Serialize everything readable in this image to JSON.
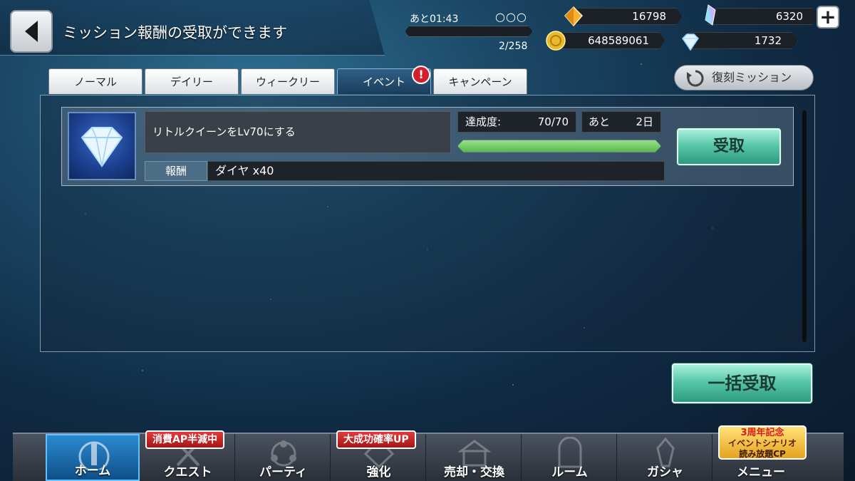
{
  "header": {
    "title": "ミッション報酬の受取ができます",
    "timer": "あと01:43",
    "stamina_circles": "○○○",
    "stamina_count": "2/258"
  },
  "resources": {
    "gold_crystal": "16798",
    "rainbow_crystal": "6320",
    "coins": "648589061",
    "diamonds": "1732"
  },
  "tabs": [
    {
      "label": "ノーマル"
    },
    {
      "label": "デイリー"
    },
    {
      "label": "ウィークリー"
    },
    {
      "label": "イベント"
    },
    {
      "label": "キャンペーン"
    }
  ],
  "active_tab": "イベント",
  "tab_badge": "!",
  "fukkoku_button": "復刻ミッション",
  "mission": {
    "description": "リトルクイーンをLv70にする",
    "progress_label": "達成度:",
    "progress_value": "70/70",
    "progress_fraction": 1.0,
    "remain_label": "あと",
    "remain_value": "2日",
    "reward_label": "報酬",
    "reward_value": "ダイヤ x40",
    "claim_button": "受取"
  },
  "claim_all_button": "一括受取",
  "nav": {
    "items": [
      {
        "label": "ホーム"
      },
      {
        "label": "クエスト"
      },
      {
        "label": "パーティ"
      },
      {
        "label": "強化"
      },
      {
        "label": "売却・交換"
      },
      {
        "label": "ルーム"
      },
      {
        "label": "ガシャ"
      },
      {
        "label": "メニュー"
      }
    ],
    "quest_ribbon": "消費AP半減中",
    "enhance_ribbon": "大成功確率UP",
    "menu_ribbon": {
      "line1": "3周年記念",
      "line2": "イベントシナリオ",
      "line3": "読み放題CP"
    }
  },
  "colors": {
    "accent_green": "#58c7a8",
    "progress_green": "#6cc45e",
    "badge_red": "#d21f2b",
    "active_nav": "#1e6fb2"
  }
}
